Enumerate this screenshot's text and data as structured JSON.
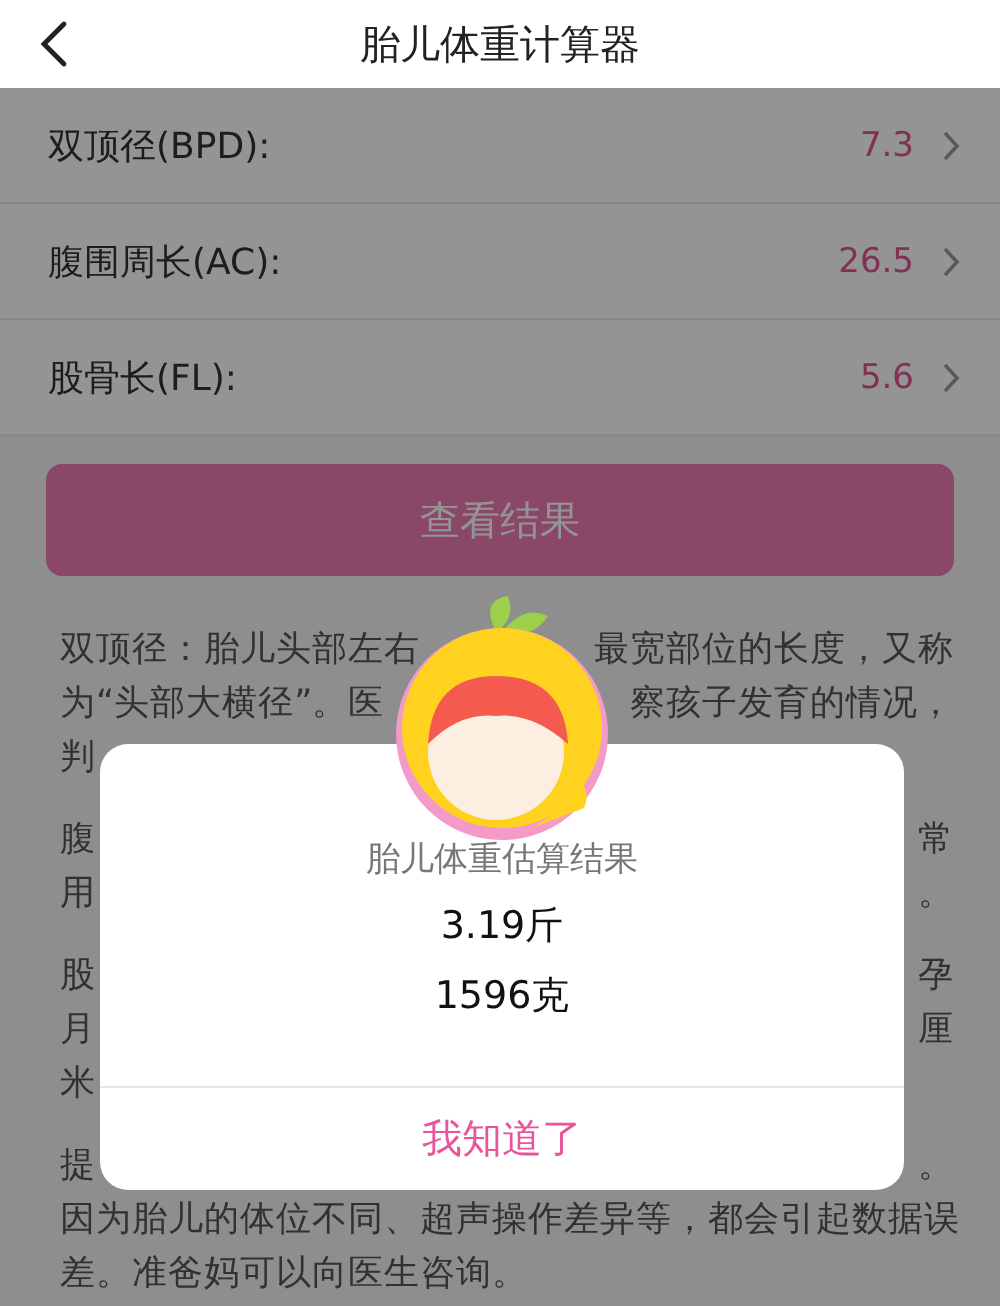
{
  "header": {
    "title": "胎儿体重计算器"
  },
  "measurements": [
    {
      "label": "双顶径(BPD):",
      "value": "7.3"
    },
    {
      "label": "腹围周长(AC):",
      "value": "26.5"
    },
    {
      "label": "股骨长(FL):",
      "value": "5.6"
    }
  ],
  "result_button": "查看结果",
  "explanation": [
    {
      "lines": [
        {
          "left": "双顶径：胎儿头部左右",
          "right": "最宽部位的长度，又称"
        },
        {
          "left": "为“头部大横径”。医",
          "right": "察孩子发育的情况，"
        },
        {
          "left": "判"
        }
      ]
    },
    {
      "lines": [
        {
          "left": "腹",
          "right": "常"
        },
        {
          "left": "用",
          "right": "。"
        }
      ]
    },
    {
      "lines": [
        {
          "left": "股",
          "right": "孕"
        },
        {
          "left": "月",
          "right": "厘"
        },
        {
          "left": "米"
        }
      ]
    },
    {
      "lines": [
        {
          "left": "提",
          "right": "。"
        },
        {
          "left": "因为胎儿的体位不同、超声操作差异等，都会引起数据误"
        },
        {
          "left": "差。准爸妈可以向医生咨询。"
        }
      ]
    }
  ],
  "dialog": {
    "title": "胎儿体重估算结果",
    "results": [
      "3.19斤",
      "1596克"
    ],
    "confirm": "我知道了"
  }
}
